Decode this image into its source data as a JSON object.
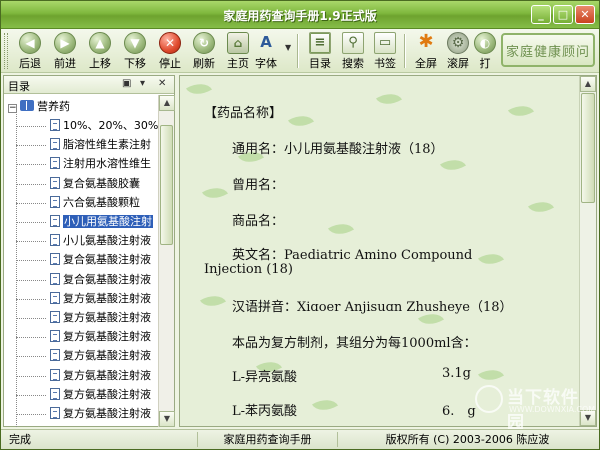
{
  "window": {
    "title": "家庭用药查询手册1.9正式版",
    "controls": [
      "minimize",
      "maximize",
      "close"
    ]
  },
  "toolbar": {
    "buttons": [
      {
        "label": "后退",
        "icon": "back-arrow-icon"
      },
      {
        "label": "前进",
        "icon": "forward-arrow-icon"
      },
      {
        "label": "上移",
        "icon": "up-arrow-icon"
      },
      {
        "label": "下移",
        "icon": "down-arrow-icon"
      },
      {
        "label": "停止",
        "icon": "stop-icon"
      },
      {
        "label": "刷新",
        "icon": "refresh-icon"
      },
      {
        "label": "主页",
        "icon": "home-icon"
      },
      {
        "label": "字体",
        "icon": "font-icon"
      },
      {
        "label": "目录",
        "icon": "contents-icon"
      },
      {
        "label": "搜索",
        "icon": "search-icon"
      },
      {
        "label": "书签",
        "icon": "bookmark-icon"
      },
      {
        "label": "全屏",
        "icon": "fullscreen-icon"
      },
      {
        "label": "滚屏",
        "icon": "scroll-icon"
      },
      {
        "label": "打",
        "icon": "print-icon"
      }
    ],
    "brand_label": "家庭健康顾问"
  },
  "sidebar": {
    "title": "目录",
    "root": "营养药",
    "items": [
      "10%、20%、30%",
      "脂溶性维生素注射",
      "注射用水溶性维生",
      "复合氨基酸胶囊",
      "六合氨基酸颗粒",
      "小儿用氨基酸注射",
      "小儿氨基酸注射液",
      "复合氨基酸注射液",
      "复合氨基酸注射液",
      "复方氨基酸注射液",
      "复方氨基酸注射液",
      "复方氨基酸注射液",
      "复方氨基酸注射液",
      "复方氨基酸注射液",
      "复方氨基酸注射液",
      "复方氨基酸注射液"
    ],
    "selected_index": 5
  },
  "content": {
    "heading": "【药品名称】",
    "generic_name": "通用名：小儿用氨基酸注射液（18）",
    "former_name": "曾用名：",
    "trade_name": "商品名：",
    "english_name_1": "英文名：Paediatric Amino Compound",
    "english_name_2": "Injection (18)",
    "pinyin": "汉语拼音：Xiɑoer Anjisuɑn Zhusheye（18）",
    "composition": "本品为复方制剂，其组分为每1000ml含：",
    "ingredient_1_name": "L-异亮氨酸",
    "ingredient_1_amount": "3.1g",
    "ingredient_2_name": "L-苯丙氨酸",
    "ingredient_2_amount": "6.　g"
  },
  "watermark": {
    "name": "当下软件园",
    "url": "WWW.DOWNXIA.COM"
  },
  "statusbar": {
    "status": "完成",
    "app_name": "家庭用药查询手册",
    "copyright": "版权所有 (C) 2003-2006 陈应波"
  }
}
